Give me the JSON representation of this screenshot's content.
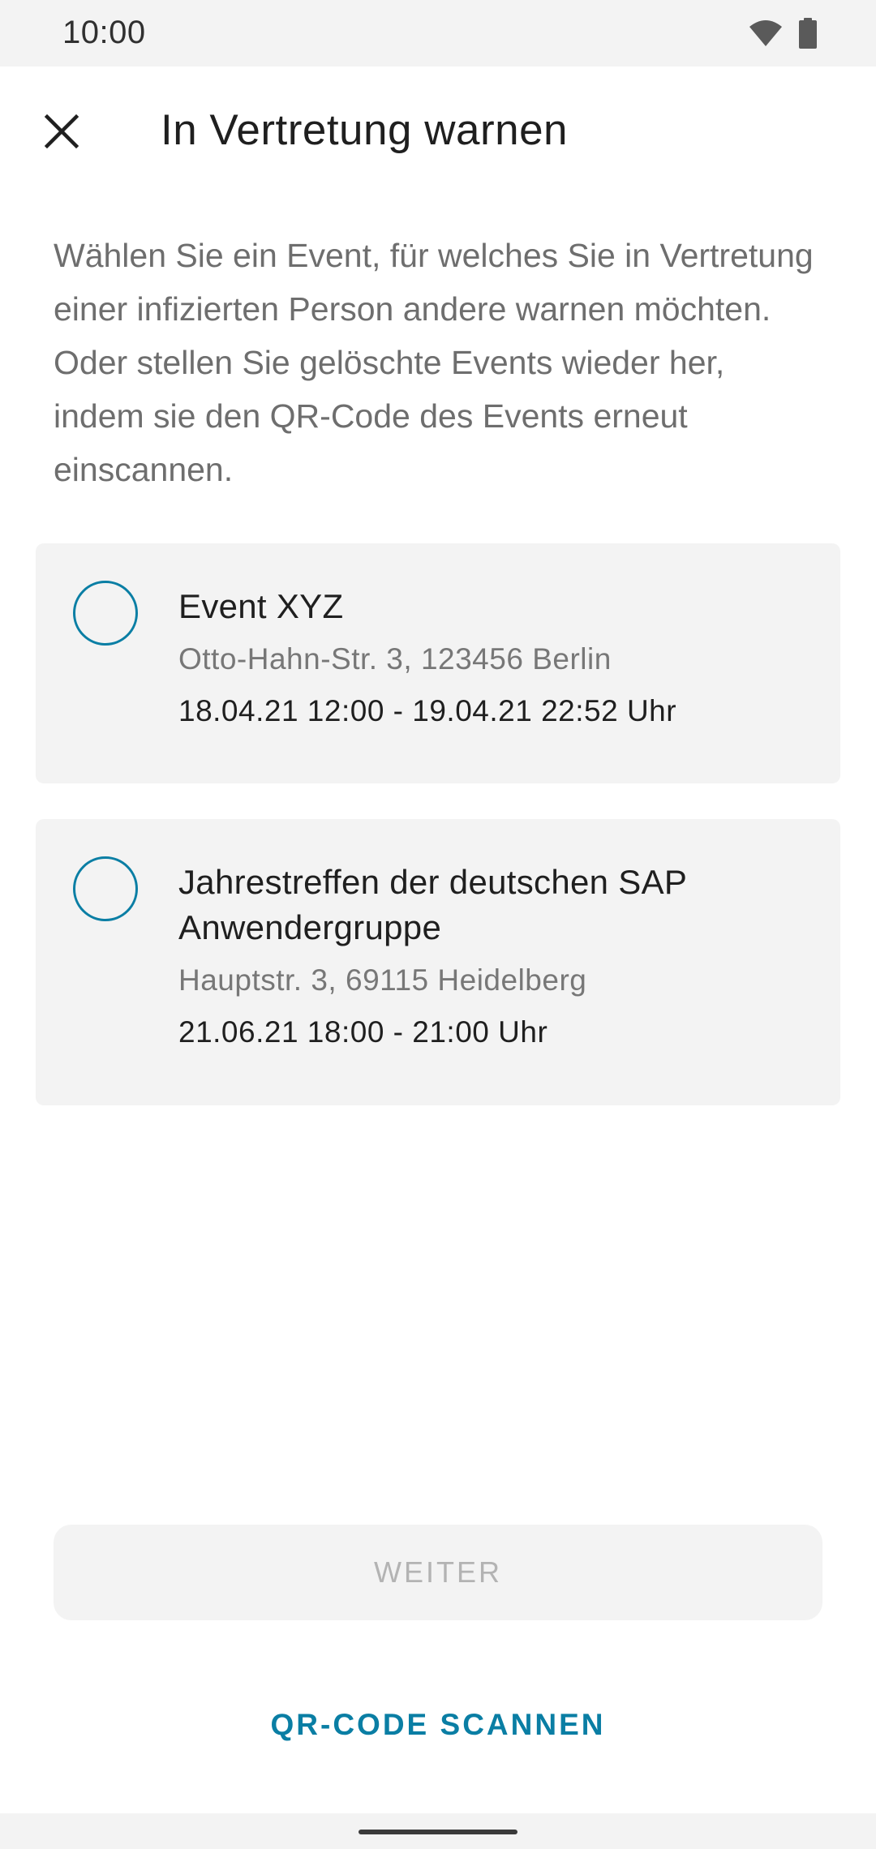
{
  "status_bar": {
    "time": "10:00",
    "icons": [
      "wifi-icon",
      "battery-icon"
    ]
  },
  "toolbar": {
    "close_icon": "close-icon",
    "title": "In Vertretung warnen"
  },
  "description": "Wählen Sie ein Event, für welches Sie in Vertretung einer infizierten Person andere warnen möchten. Oder stellen Sie gelöschte Events wieder her, indem sie den QR-Code des Events erneut einscannen.",
  "events": [
    {
      "title": "Event XYZ",
      "address": "Otto-Hahn-Str. 3, 123456 Berlin",
      "time": "18.04.21 12:00 - 19.04.21 22:52 Uhr",
      "selected": false
    },
    {
      "title": "Jahrestreffen der deutschen SAP Anwendergruppe",
      "address": "Hauptstr. 3, 69115 Heidelberg",
      "time": "21.06.21 18:00 - 21:00 Uhr",
      "selected": false
    }
  ],
  "buttons": {
    "continue_label": "WEITER",
    "continue_enabled": false,
    "scan_label": "QR-CODE SCANNEN"
  },
  "colors": {
    "accent": "#0a7ea4",
    "card_background": "#f3f3f3",
    "disabled_text": "#b3b3b3"
  }
}
